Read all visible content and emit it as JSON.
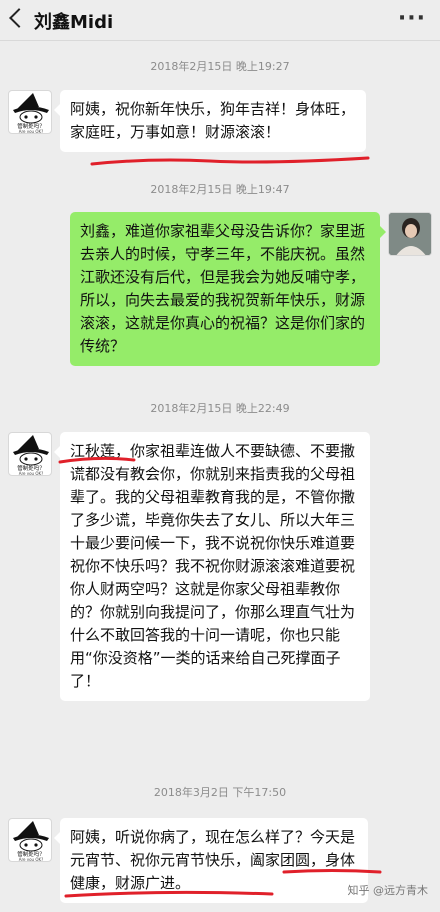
{
  "header": {
    "back_icon": "chevron-left-icon",
    "title": "刘鑫Midi",
    "more_icon": "more-dots-icon",
    "more_glyph": "···"
  },
  "avatar_left": {
    "caption_top": "管制处吗？",
    "caption_bottom": "Are you OK?"
  },
  "messages": [
    {
      "time": "2018年2月15日 晚上19:27",
      "side": "left",
      "text": "阿姨，祝你新年快乐，狗年吉祥！身体旺，家庭旺，万事如意！财源滚滚！"
    },
    {
      "time": "2018年2月15日 晚上19:47",
      "side": "right",
      "text": "刘鑫，难道你家祖辈父母没告诉你？家里逝去亲人的时候，守孝三年，不能庆祝。虽然江歌还没有后代，但是我会为她反哺守孝，所以，向失去最爱的我祝贺新年快乐，财源滚滚，这就是你真心的祝福？这是你们家的传统？"
    },
    {
      "time": "2018年2月15日 晚上22:49",
      "side": "left",
      "text": "江秋莲，你家祖辈连做人不要缺德、不要撒谎都没有教会你，你就别来指责我的父母祖辈了。我的父母祖辈教育我的是，不管你撒了多少谎，毕竟你失去了女儿、所以大年三十最少要问候一下，我不说祝你快乐难道要祝你不快乐吗？我不祝你财源滚滚难道要祝你人财两空吗？这就是你家父母祖辈教你的？你就别向我提问了，你那么理直气壮为什么不敢回答我的十问一请呢，你也只能用“你没资格”一类的话来给自己死撑面子了！"
    },
    {
      "time": "2018年3月2日 下午17:50",
      "side": "left",
      "text": "阿姨，听说你病了，现在怎么样了？今天是元宵节、祝你元宵节快乐，阖家团圆，身体健康，财源广进。"
    }
  ],
  "watermark": "知乎 @远方青木",
  "colors": {
    "background": "#ededed",
    "sent_bubble": "#95ec69",
    "received_bubble": "#ffffff",
    "annotation": "#e0202a"
  }
}
